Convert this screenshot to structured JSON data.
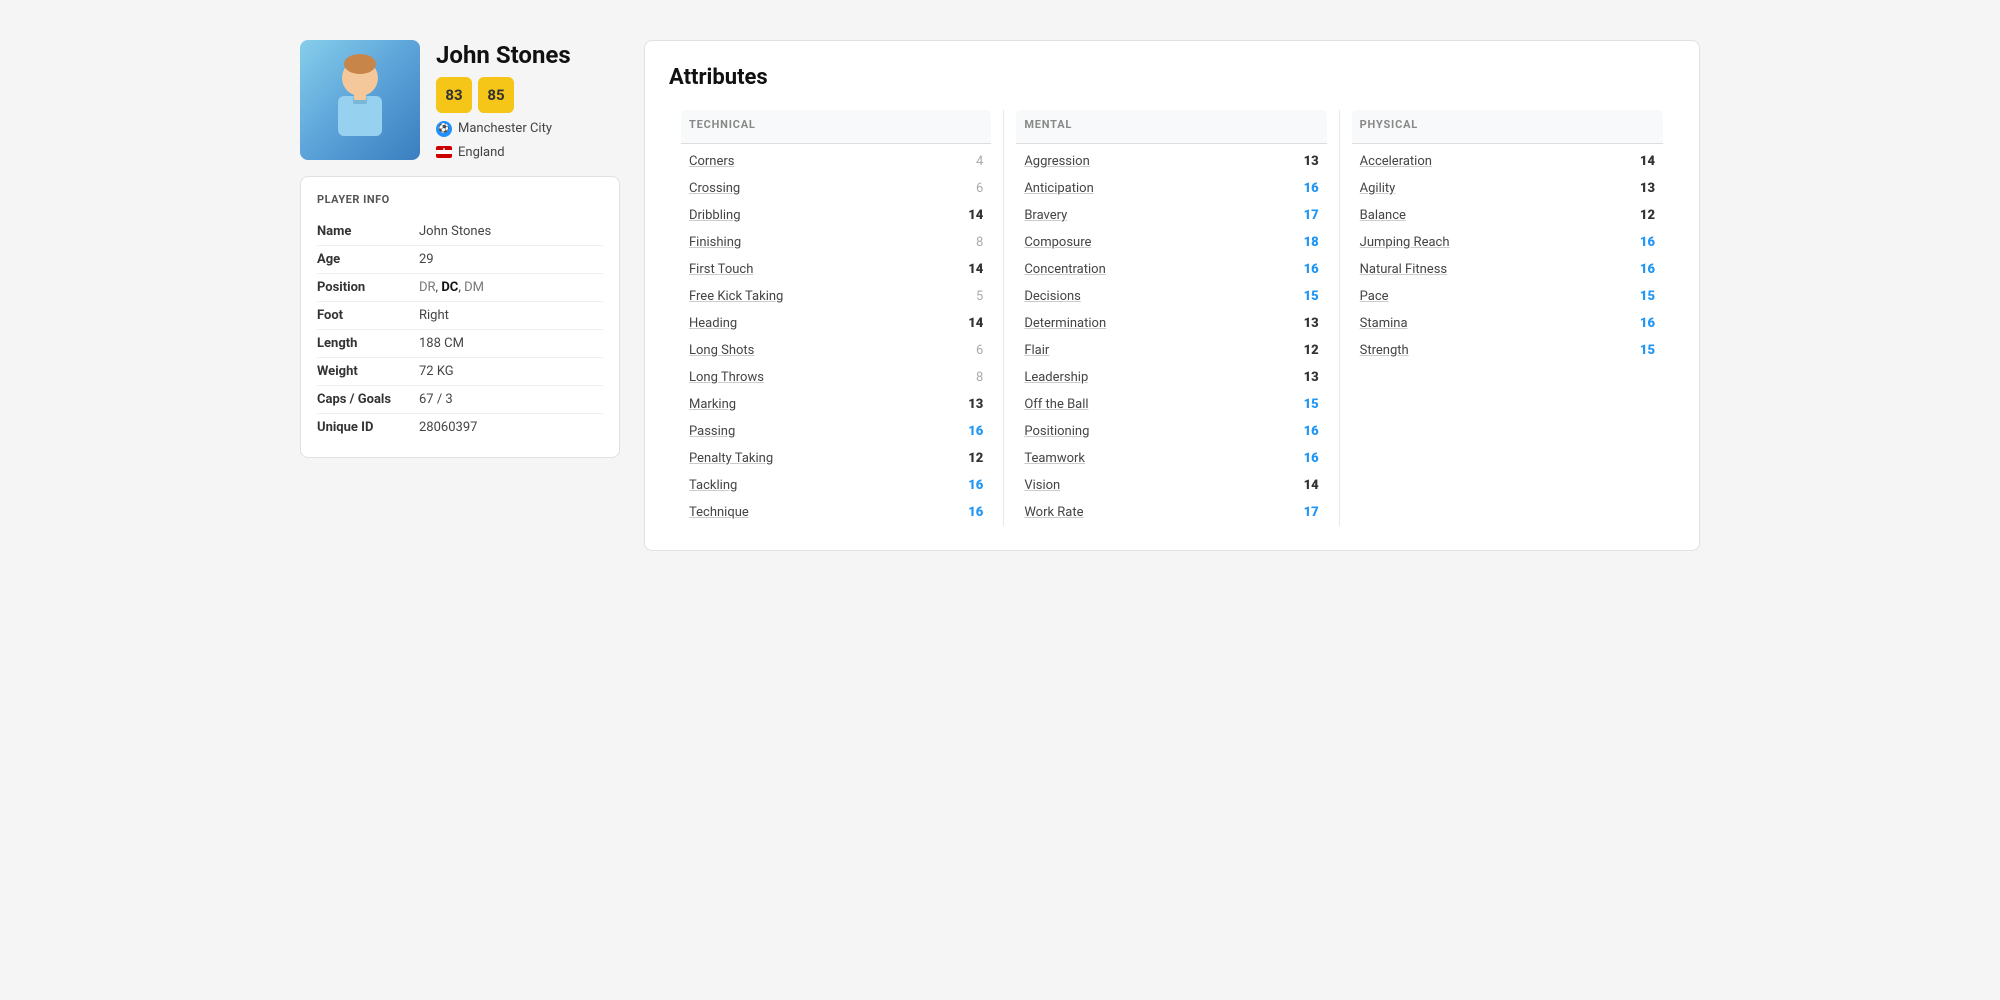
{
  "player": {
    "name": "John Stones",
    "rating1": "83",
    "rating2": "85",
    "club": "Manchester City",
    "nation": "England",
    "photo_label": "player-photo"
  },
  "playerInfo": {
    "title": "PLAYER INFO",
    "rows": [
      {
        "label": "Name",
        "value": "John Stones",
        "positions": null
      },
      {
        "label": "Age",
        "value": "29",
        "positions": null
      },
      {
        "label": "Position",
        "value": null,
        "positions": [
          "DR",
          "DC",
          "DM"
        ]
      },
      {
        "label": "Foot",
        "value": "Right",
        "positions": null
      },
      {
        "label": "Length",
        "value": "188 CM",
        "positions": null
      },
      {
        "label": "Weight",
        "value": "72 KG",
        "positions": null
      },
      {
        "label": "Caps / Goals",
        "value": "67 / 3",
        "positions": null
      },
      {
        "label": "Unique ID",
        "value": "28060397",
        "positions": null
      }
    ]
  },
  "attributes": {
    "title": "Attributes",
    "technical": {
      "header": "TECHNICAL",
      "rows": [
        {
          "name": "Corners",
          "value": "4",
          "class": "low"
        },
        {
          "name": "Crossing",
          "value": "6",
          "class": "low"
        },
        {
          "name": "Dribbling",
          "value": "14",
          "class": "normal"
        },
        {
          "name": "Finishing",
          "value": "8",
          "class": "low"
        },
        {
          "name": "First Touch",
          "value": "14",
          "class": "normal"
        },
        {
          "name": "Free Kick Taking",
          "value": "5",
          "class": "low"
        },
        {
          "name": "Heading",
          "value": "14",
          "class": "normal"
        },
        {
          "name": "Long Shots",
          "value": "6",
          "class": "low"
        },
        {
          "name": "Long Throws",
          "value": "8",
          "class": "low"
        },
        {
          "name": "Marking",
          "value": "13",
          "class": "normal"
        },
        {
          "name": "Passing",
          "value": "16",
          "class": "high"
        },
        {
          "name": "Penalty Taking",
          "value": "12",
          "class": "normal"
        },
        {
          "name": "Tackling",
          "value": "16",
          "class": "high"
        },
        {
          "name": "Technique",
          "value": "16",
          "class": "high"
        }
      ]
    },
    "mental": {
      "header": "MENTAL",
      "rows": [
        {
          "name": "Aggression",
          "value": "13",
          "class": "normal"
        },
        {
          "name": "Anticipation",
          "value": "16",
          "class": "high"
        },
        {
          "name": "Bravery",
          "value": "17",
          "class": "high"
        },
        {
          "name": "Composure",
          "value": "18",
          "class": "high"
        },
        {
          "name": "Concentration",
          "value": "16",
          "class": "high"
        },
        {
          "name": "Decisions",
          "value": "15",
          "class": "high"
        },
        {
          "name": "Determination",
          "value": "13",
          "class": "normal"
        },
        {
          "name": "Flair",
          "value": "12",
          "class": "normal"
        },
        {
          "name": "Leadership",
          "value": "13",
          "class": "normal"
        },
        {
          "name": "Off the Ball",
          "value": "15",
          "class": "high"
        },
        {
          "name": "Positioning",
          "value": "16",
          "class": "high"
        },
        {
          "name": "Teamwork",
          "value": "16",
          "class": "high"
        },
        {
          "name": "Vision",
          "value": "14",
          "class": "normal"
        },
        {
          "name": "Work Rate",
          "value": "17",
          "class": "high"
        }
      ]
    },
    "physical": {
      "header": "PHYSICAL",
      "rows": [
        {
          "name": "Acceleration",
          "value": "14",
          "class": "normal"
        },
        {
          "name": "Agility",
          "value": "13",
          "class": "normal"
        },
        {
          "name": "Balance",
          "value": "12",
          "class": "normal"
        },
        {
          "name": "Jumping Reach",
          "value": "16",
          "class": "high"
        },
        {
          "name": "Natural Fitness",
          "value": "16",
          "class": "high"
        },
        {
          "name": "Pace",
          "value": "15",
          "class": "high"
        },
        {
          "name": "Stamina",
          "value": "16",
          "class": "high"
        },
        {
          "name": "Strength",
          "value": "15",
          "class": "high"
        }
      ]
    }
  }
}
